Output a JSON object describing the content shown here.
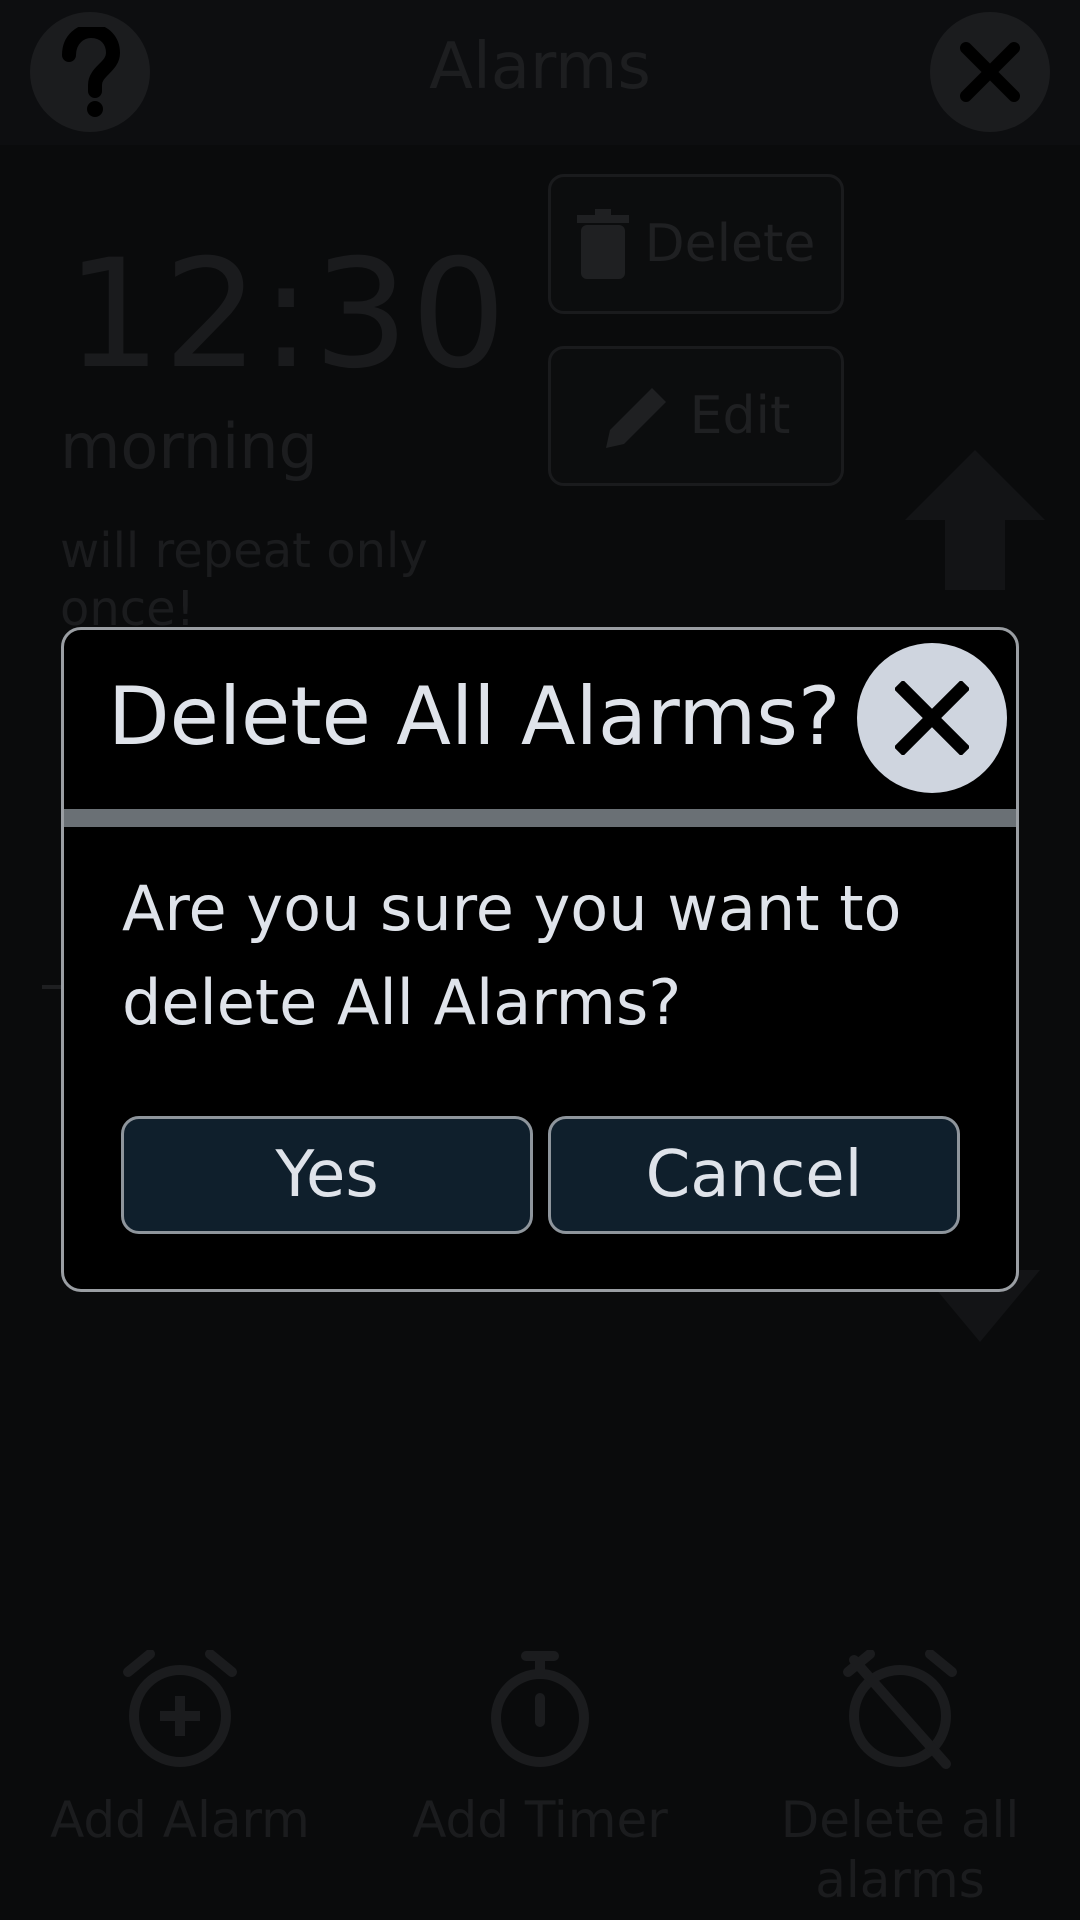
{
  "header": {
    "title": "Alarms",
    "help_icon": "question-mark-icon",
    "close_icon": "close-icon"
  },
  "alarm": {
    "time": "12:30",
    "period": "morning",
    "repeat": "will repeat only once!",
    "delete_label": "Delete",
    "edit_label": "Edit"
  },
  "bottom_bar": {
    "add_alarm": "Add Alarm",
    "add_timer": "Add Timer",
    "delete_all": "Delete all alarms"
  },
  "dialog": {
    "title": "Delete All Alarms?",
    "message": "Are you sure you want to delete All Alarms?",
    "yes_label": "Yes",
    "cancel_label": "Cancel"
  },
  "colors": {
    "dialog_text": "#dfe3ea",
    "dialog_button_bg": "#0f1f2c",
    "dialog_border": "#9a9ea3",
    "divider": "#6a7075",
    "close_circle": "#cfd5df"
  }
}
